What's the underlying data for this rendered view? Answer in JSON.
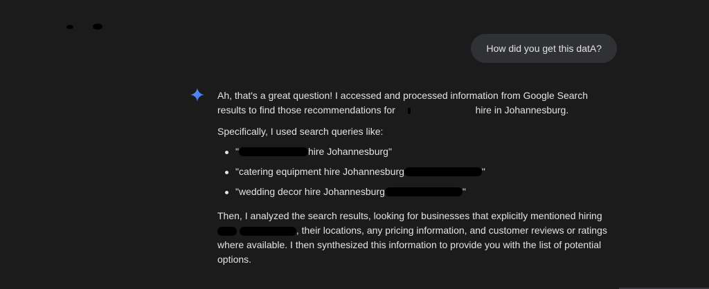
{
  "user_message": "How did you get this datA?",
  "response": {
    "para1_part1": "Ah, that's a great question! I accessed and processed information from Google Search results to find those recommendations for",
    "para1_part2": "hire in Johannesburg.",
    "para2": "Specifically, I used search queries like:",
    "bullets": [
      {
        "before": "\"",
        "after": " hire Johannesburg\""
      },
      {
        "before": "\"catering equipment hire Johannesburg ",
        "after": "\""
      },
      {
        "before": "\"wedding decor hire Johannesburg ",
        "after": " \""
      }
    ],
    "para3_part1": "Then, I analyzed the search results, looking for businesses that explicitly mentioned hiring",
    "para3_part2": ", their locations, any pricing information, and customer reviews or ratings where available. I then synthesized this information to provide you with the list of potential options."
  },
  "icons": {
    "assistant": "sparkle-icon"
  },
  "colors": {
    "background": "#1b1b1c",
    "bubble": "#303134",
    "text": "#e3e3e3",
    "sparkle_blue": "#4285f4"
  }
}
